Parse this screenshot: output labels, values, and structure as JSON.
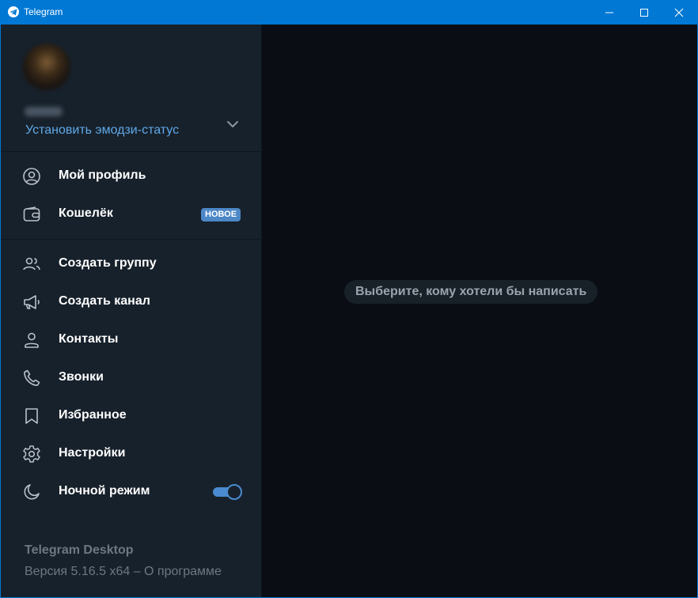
{
  "window": {
    "title": "Telegram",
    "controls": [
      "minimize",
      "maximize",
      "close"
    ]
  },
  "sidebar": {
    "emoji_status_link": "Установить эмодзи-статус",
    "menu": [
      {
        "id": "profile",
        "label": "Мой профиль",
        "icon": "user-circle-icon"
      },
      {
        "id": "wallet",
        "label": "Кошелёк",
        "icon": "wallet-icon",
        "badge": "НОВОЕ"
      },
      {
        "id": "new-group",
        "label": "Создать группу",
        "icon": "users-icon"
      },
      {
        "id": "new-channel",
        "label": "Создать канал",
        "icon": "megaphone-icon"
      },
      {
        "id": "contacts",
        "label": "Контакты",
        "icon": "person-icon"
      },
      {
        "id": "calls",
        "label": "Звонки",
        "icon": "phone-icon"
      },
      {
        "id": "saved",
        "label": "Избранное",
        "icon": "bookmark-icon"
      },
      {
        "id": "settings",
        "label": "Настройки",
        "icon": "gear-icon"
      },
      {
        "id": "night-mode",
        "label": "Ночной режим",
        "icon": "moon-icon",
        "toggle": true
      }
    ],
    "footer": {
      "app_name": "Telegram Desktop",
      "version": "Версия 5.16.5 x64 – О программе"
    }
  },
  "main": {
    "empty_message": "Выберите, кому хотели бы написать"
  },
  "colors": {
    "titlebar": "#0078d4",
    "sidebar_bg": "#17212b",
    "main_bg": "#0a0e14",
    "accent": "#5fa8e8",
    "badge": "#4c87c6"
  }
}
